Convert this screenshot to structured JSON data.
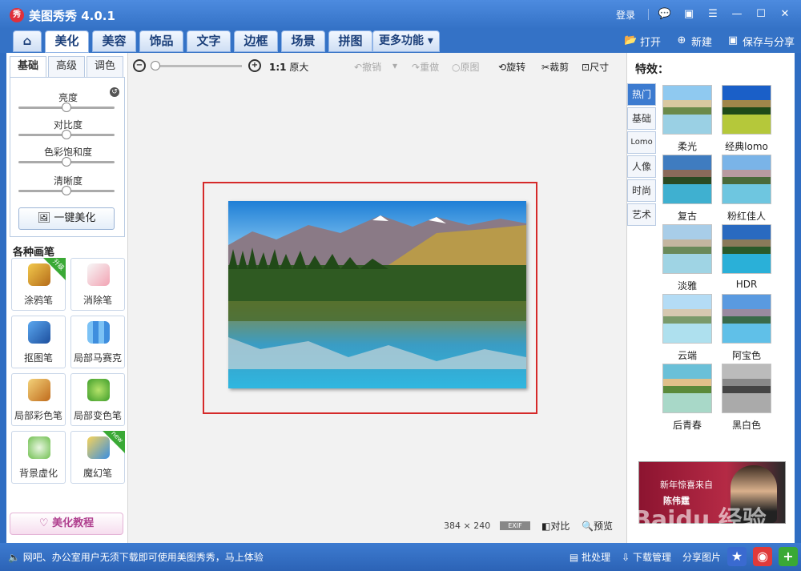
{
  "app": {
    "title": "美图秀秀 4.0.1",
    "logo_text": "秀"
  },
  "titlebar": {
    "login": "登录",
    "icons": [
      "chat-icon",
      "skin-icon",
      "menu-icon",
      "minimize-icon",
      "maximize-icon",
      "close-icon"
    ]
  },
  "nav": {
    "tabs": [
      {
        "label": "美化",
        "active": true
      },
      {
        "label": "美容"
      },
      {
        "label": "饰品"
      },
      {
        "label": "文字"
      },
      {
        "label": "边框"
      },
      {
        "label": "场景"
      },
      {
        "label": "拼图"
      },
      {
        "label": "更多功能"
      }
    ],
    "actions": {
      "open": "打开",
      "new": "新建",
      "save_share": "保存与分享"
    }
  },
  "left": {
    "subtabs": [
      {
        "label": "基础",
        "active": true
      },
      {
        "label": "高级"
      },
      {
        "label": "调色"
      }
    ],
    "sliders": [
      {
        "label": "亮度",
        "value": 0.5
      },
      {
        "label": "对比度",
        "value": 0.5
      },
      {
        "label": "色彩饱和度",
        "value": 0.5
      },
      {
        "label": "清晰度",
        "value": 0.5
      }
    ],
    "one_key": "一键美化",
    "brushes_title": "各种画笔",
    "brushes": [
      {
        "label": "涂鸦笔",
        "tag": "升级"
      },
      {
        "label": "消除笔"
      },
      {
        "label": "抠图笔"
      },
      {
        "label": "局部马赛克"
      },
      {
        "label": "局部彩色笔"
      },
      {
        "label": "局部变色笔"
      },
      {
        "label": "背景虚化"
      },
      {
        "label": "魔幻笔",
        "tag": "new"
      }
    ],
    "tutorial": "美化教程"
  },
  "toolbar": {
    "ratio": "1:1",
    "original_size": "原大",
    "undo": "撤销",
    "redo": "重做",
    "origin_image": "原图",
    "rotate": "旋转",
    "crop": "裁剪",
    "resize": "尺寸"
  },
  "canvas": {
    "width": "384",
    "height": "240",
    "exif": "EXIF",
    "compare": "对比",
    "preview": "预览"
  },
  "effects": {
    "title": "特效：",
    "tabs": [
      {
        "label": "热门",
        "active": true
      },
      {
        "label": "基础"
      },
      {
        "label": "Lomo"
      },
      {
        "label": "人像"
      },
      {
        "label": "时尚"
      },
      {
        "label": "艺术"
      }
    ],
    "items": [
      {
        "label": "柔光"
      },
      {
        "label": "经典lomo"
      },
      {
        "label": "复古"
      },
      {
        "label": "粉红佳人"
      },
      {
        "label": "淡雅"
      },
      {
        "label": "HDR"
      },
      {
        "label": "云端"
      },
      {
        "label": "阿宝色"
      },
      {
        "label": "后青春"
      },
      {
        "label": "黑白色"
      }
    ],
    "ad": {
      "line1": "新年惊喜来自",
      "line2": "陈伟霆"
    }
  },
  "status": {
    "message": "网吧、办公室用户无须下载即可使用美图秀秀，马上体验",
    "batch": "批处理",
    "download_manager": "下载管理",
    "share_image": "分享图片"
  },
  "watermark": "Baidu 经验"
}
